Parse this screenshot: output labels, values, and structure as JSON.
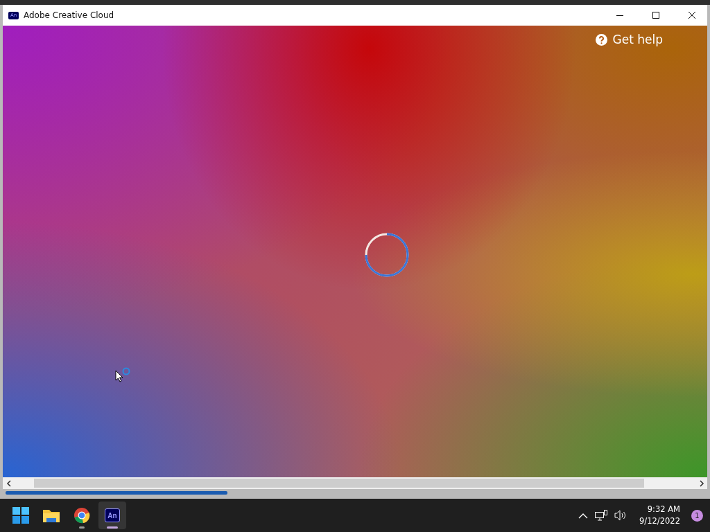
{
  "window": {
    "icon_text": "An",
    "title": "Adobe Creative Cloud"
  },
  "content": {
    "help_label": "Get help"
  },
  "taskbar": {
    "apps": [
      {
        "kind": "start",
        "running": false,
        "selected": false
      },
      {
        "kind": "explorer",
        "running": false,
        "selected": false
      },
      {
        "kind": "browser",
        "running": true,
        "selected": false
      },
      {
        "kind": "animate",
        "label": "An",
        "running": true,
        "selected": true
      }
    ],
    "time": "9:32 AM",
    "date": "9/12/2022",
    "notification_count": "1"
  }
}
